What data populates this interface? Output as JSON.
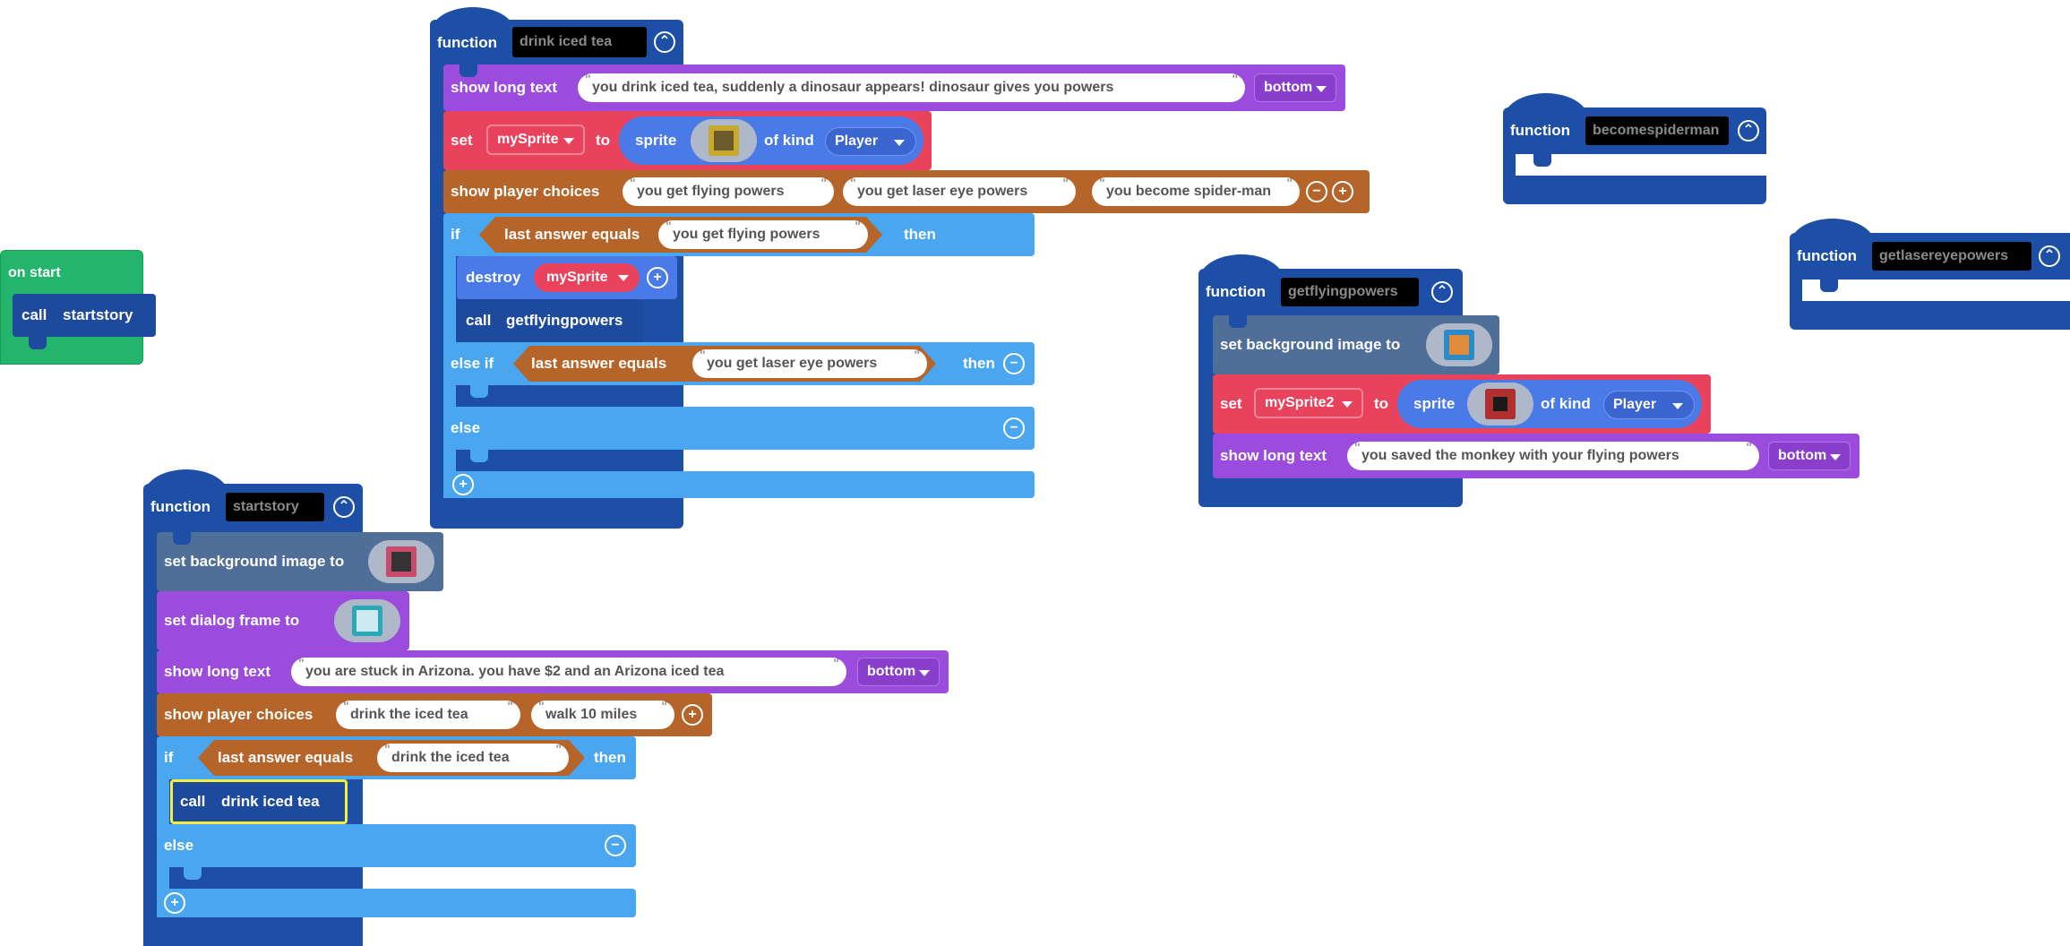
{
  "colors": {
    "function": "#1e4fa6",
    "events": "#23b56b",
    "story": "#9c4cdc",
    "sprites": "#e8425c",
    "logic": "#4aa6ee",
    "scene": "#4f6f99",
    "loops": "#b5652a",
    "call": "#1d4a9c"
  },
  "on_start": {
    "label": "on start",
    "call_label": "call",
    "call_target": "startstory"
  },
  "fn_drink": {
    "keyword": "function",
    "name": "drink iced tea",
    "long_text_label": "show long text",
    "long_text_value": "you drink iced tea, suddenly a dinosaur appears! dinosaur gives you powers",
    "long_text_pos": "bottom",
    "set_label": "set",
    "set_var": "mySprite",
    "to_label": "to",
    "sprite_label": "sprite",
    "of_kind_label": "of kind",
    "kind_value": "Player",
    "choices_label": "show player choices",
    "choices": [
      "you get flying powers",
      "you get laser eye powers",
      "you become spider-man"
    ],
    "if_label": "if",
    "last_answer_label": "last answer equals",
    "if_value": "you get flying powers",
    "then_label": "then",
    "destroy_label": "destroy",
    "destroy_var": "mySprite",
    "call_label": "call",
    "call_target": "getflyingpowers",
    "elseif_label": "else if",
    "elseif_value": "you get laser eye powers",
    "else_label": "else"
  },
  "fn_startstory": {
    "keyword": "function",
    "name": "startstory",
    "bg_label": "set background image to",
    "dialog_label": "set dialog frame to",
    "long_text_label": "show long text",
    "long_text_value": "you are stuck in Arizona. you have $2 and an Arizona iced tea",
    "long_text_pos": "bottom",
    "choices_label": "show player choices",
    "choices": [
      "drink the iced tea",
      "walk 10 miles"
    ],
    "if_label": "if",
    "last_answer_label": "last answer equals",
    "if_value": "drink the iced tea",
    "then_label": "then",
    "call_label": "call",
    "call_target": "drink iced tea",
    "else_label": "else"
  },
  "fn_flying": {
    "keyword": "function",
    "name": "getflyingpowers",
    "bg_label": "set background image to",
    "set_label": "set",
    "set_var": "mySprite2",
    "to_label": "to",
    "sprite_label": "sprite",
    "of_kind_label": "of kind",
    "kind_value": "Player",
    "long_text_label": "show long text",
    "long_text_value": "you saved the monkey with your flying powers",
    "long_text_pos": "bottom"
  },
  "fn_spider": {
    "keyword": "function",
    "name": "becomespiderman"
  },
  "fn_laser": {
    "keyword": "function",
    "name": "getlasereyepowers"
  }
}
